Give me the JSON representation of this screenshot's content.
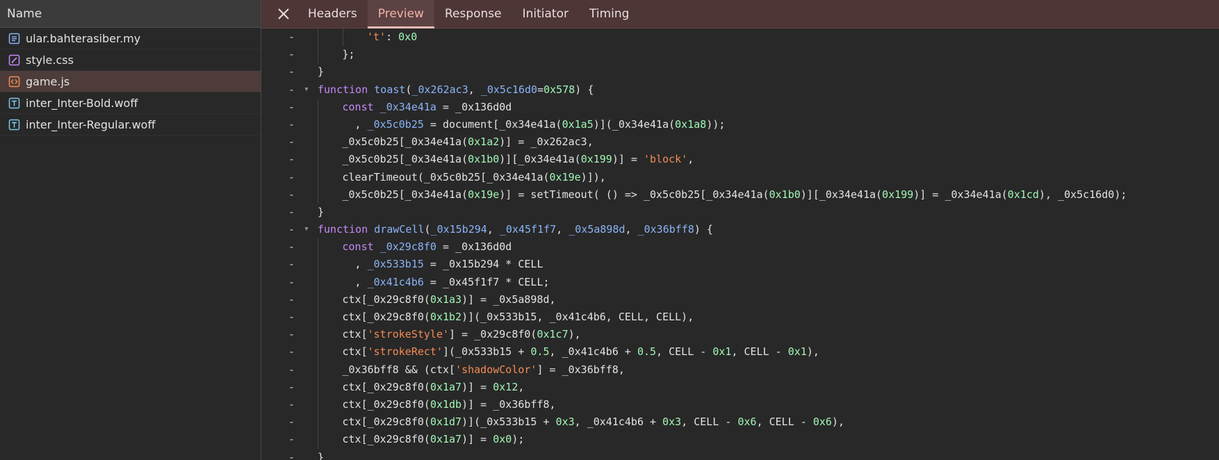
{
  "network": {
    "name_header": "Name",
    "files": [
      {
        "name": "ular.bahterasiber.my",
        "type": "document",
        "icon": "document-icon",
        "color": "#8ab4f8",
        "selected": false
      },
      {
        "name": "style.css",
        "type": "stylesheet",
        "icon": "stylesheet-icon",
        "color": "#c58af9",
        "selected": false
      },
      {
        "name": "game.js",
        "type": "script",
        "icon": "script-icon",
        "color": "#f28b54",
        "selected": true
      },
      {
        "name": "inter_Inter-Bold.woff",
        "type": "font",
        "icon": "font-icon",
        "color": "#7cc6e8",
        "selected": false
      },
      {
        "name": "inter_Inter-Regular.woff",
        "type": "font",
        "icon": "font-icon",
        "color": "#7cc6e8",
        "selected": false
      }
    ]
  },
  "tabs": {
    "close_icon": "close-icon",
    "items": [
      {
        "id": "headers",
        "label": "Headers",
        "active": false
      },
      {
        "id": "preview",
        "label": "Preview",
        "active": true
      },
      {
        "id": "response",
        "label": "Response",
        "active": false
      },
      {
        "id": "initiator",
        "label": "Initiator",
        "active": false
      },
      {
        "id": "timing",
        "label": "Timing",
        "active": false
      }
    ]
  },
  "code": {
    "gutter_mark": "-",
    "fold_icon": "fold-arrow-icon",
    "lines": [
      {
        "indent": 2,
        "fold": false,
        "tokens": [
          [
            "st",
            "'t'"
          ],
          [
            "",
            ": "
          ],
          [
            "nm",
            "0x0"
          ]
        ]
      },
      {
        "indent": 1,
        "fold": false,
        "tokens": [
          [
            "",
            "};"
          ]
        ]
      },
      {
        "indent": 0,
        "fold": false,
        "tokens": [
          [
            "",
            "}"
          ]
        ]
      },
      {
        "indent": 0,
        "fold": true,
        "tokens": [
          [
            "kw",
            "function"
          ],
          [
            "",
            " "
          ],
          [
            "fn",
            "toast"
          ],
          [
            "",
            "("
          ],
          [
            "pm",
            "_0x262ac3"
          ],
          [
            "",
            ", "
          ],
          [
            "pm",
            "_0x5c16d0"
          ],
          [
            "",
            "="
          ],
          [
            "nm",
            "0x578"
          ],
          [
            "",
            ") {"
          ]
        ]
      },
      {
        "indent": 1,
        "fold": false,
        "tokens": [
          [
            "kw",
            "const"
          ],
          [
            "",
            " "
          ],
          [
            "pm",
            "_0x34e41a"
          ],
          [
            "",
            " = _0x136d0d"
          ]
        ]
      },
      {
        "indent": 1,
        "fold": false,
        "tokens": [
          [
            "",
            "  , "
          ],
          [
            "pm",
            "_0x5c0b25"
          ],
          [
            "",
            " = document[_0x34e41a("
          ],
          [
            "nm",
            "0x1a5"
          ],
          [
            "",
            ")](_0x34e41a("
          ],
          [
            "nm",
            "0x1a8"
          ],
          [
            "",
            "));"
          ]
        ]
      },
      {
        "indent": 1,
        "fold": false,
        "tokens": [
          [
            "",
            "_0x5c0b25[_0x34e41a("
          ],
          [
            "nm",
            "0x1a2"
          ],
          [
            "",
            ")] = _0x262ac3,"
          ]
        ]
      },
      {
        "indent": 1,
        "fold": false,
        "tokens": [
          [
            "",
            "_0x5c0b25[_0x34e41a("
          ],
          [
            "nm",
            "0x1b0"
          ],
          [
            "",
            ")][_0x34e41a("
          ],
          [
            "nm",
            "0x199"
          ],
          [
            "",
            ")] = "
          ],
          [
            "st",
            "'block'"
          ],
          [
            "",
            ","
          ]
        ]
      },
      {
        "indent": 1,
        "fold": false,
        "tokens": [
          [
            "",
            "clearTimeout(_0x5c0b25[_0x34e41a("
          ],
          [
            "nm",
            "0x19e"
          ],
          [
            "",
            ")]),"
          ]
        ]
      },
      {
        "indent": 1,
        "fold": false,
        "tokens": [
          [
            "",
            "_0x5c0b25[_0x34e41a("
          ],
          [
            "nm",
            "0x19e"
          ],
          [
            "",
            ")] = setTimeout( () => _0x5c0b25[_0x34e41a("
          ],
          [
            "nm",
            "0x1b0"
          ],
          [
            "",
            ")][_0x34e41a("
          ],
          [
            "nm",
            "0x199"
          ],
          [
            "",
            ")] = _0x34e41a("
          ],
          [
            "nm",
            "0x1cd"
          ],
          [
            "",
            "), _0x5c16d0);"
          ]
        ]
      },
      {
        "indent": 0,
        "fold": false,
        "tokens": [
          [
            "",
            "}"
          ]
        ]
      },
      {
        "indent": 0,
        "fold": true,
        "tokens": [
          [
            "kw",
            "function"
          ],
          [
            "",
            " "
          ],
          [
            "fn",
            "drawCell"
          ],
          [
            "",
            "("
          ],
          [
            "pm",
            "_0x15b294"
          ],
          [
            "",
            ", "
          ],
          [
            "pm",
            "_0x45f1f7"
          ],
          [
            "",
            ", "
          ],
          [
            "pm",
            "_0x5a898d"
          ],
          [
            "",
            ", "
          ],
          [
            "pm",
            "_0x36bff8"
          ],
          [
            "",
            ") {"
          ]
        ]
      },
      {
        "indent": 1,
        "fold": false,
        "tokens": [
          [
            "kw",
            "const"
          ],
          [
            "",
            " "
          ],
          [
            "pm",
            "_0x29c8f0"
          ],
          [
            "",
            " = _0x136d0d"
          ]
        ]
      },
      {
        "indent": 1,
        "fold": false,
        "tokens": [
          [
            "",
            "  , "
          ],
          [
            "pm",
            "_0x533b15"
          ],
          [
            "",
            " = _0x15b294 * CELL"
          ]
        ]
      },
      {
        "indent": 1,
        "fold": false,
        "tokens": [
          [
            "",
            "  , "
          ],
          [
            "pm",
            "_0x41c4b6"
          ],
          [
            "",
            " = _0x45f1f7 * CELL;"
          ]
        ]
      },
      {
        "indent": 1,
        "fold": false,
        "tokens": [
          [
            "",
            "ctx[_0x29c8f0("
          ],
          [
            "nm",
            "0x1a3"
          ],
          [
            "",
            ")] = _0x5a898d,"
          ]
        ]
      },
      {
        "indent": 1,
        "fold": false,
        "tokens": [
          [
            "",
            "ctx[_0x29c8f0("
          ],
          [
            "nm",
            "0x1b2"
          ],
          [
            "",
            ")](_0x533b15, _0x41c4b6, CELL, CELL),"
          ]
        ]
      },
      {
        "indent": 1,
        "fold": false,
        "tokens": [
          [
            "",
            "ctx["
          ],
          [
            "st",
            "'strokeStyle'"
          ],
          [
            "",
            "] = _0x29c8f0("
          ],
          [
            "nm",
            "0x1c7"
          ],
          [
            "",
            "),"
          ]
        ]
      },
      {
        "indent": 1,
        "fold": false,
        "tokens": [
          [
            "",
            "ctx["
          ],
          [
            "st",
            "'strokeRect'"
          ],
          [
            "",
            "](_0x533b15 + "
          ],
          [
            "nm",
            "0.5"
          ],
          [
            "",
            ", _0x41c4b6 + "
          ],
          [
            "nm",
            "0.5"
          ],
          [
            "",
            ", CELL - "
          ],
          [
            "nm",
            "0x1"
          ],
          [
            "",
            ", CELL - "
          ],
          [
            "nm",
            "0x1"
          ],
          [
            "",
            "),"
          ]
        ]
      },
      {
        "indent": 1,
        "fold": false,
        "tokens": [
          [
            "",
            "_0x36bff8 && (ctx["
          ],
          [
            "st",
            "'shadowColor'"
          ],
          [
            "",
            "] = _0x36bff8,"
          ]
        ]
      },
      {
        "indent": 1,
        "fold": false,
        "tokens": [
          [
            "",
            "ctx[_0x29c8f0("
          ],
          [
            "nm",
            "0x1a7"
          ],
          [
            "",
            ")] = "
          ],
          [
            "nm",
            "0x12"
          ],
          [
            "",
            ","
          ]
        ]
      },
      {
        "indent": 1,
        "fold": false,
        "tokens": [
          [
            "",
            "ctx[_0x29c8f0("
          ],
          [
            "nm",
            "0x1db"
          ],
          [
            "",
            ")] = _0x36bff8,"
          ]
        ]
      },
      {
        "indent": 1,
        "fold": false,
        "tokens": [
          [
            "",
            "ctx[_0x29c8f0("
          ],
          [
            "nm",
            "0x1d7"
          ],
          [
            "",
            ")](_0x533b15 + "
          ],
          [
            "nm",
            "0x3"
          ],
          [
            "",
            ", _0x41c4b6 + "
          ],
          [
            "nm",
            "0x3"
          ],
          [
            "",
            ", CELL - "
          ],
          [
            "nm",
            "0x6"
          ],
          [
            "",
            ", CELL - "
          ],
          [
            "nm",
            "0x6"
          ],
          [
            "",
            "),"
          ]
        ]
      },
      {
        "indent": 1,
        "fold": false,
        "tokens": [
          [
            "",
            "ctx[_0x29c8f0("
          ],
          [
            "nm",
            "0x1a7"
          ],
          [
            "",
            ")] = "
          ],
          [
            "nm",
            "0x0"
          ],
          [
            "",
            ");"
          ]
        ]
      },
      {
        "indent": 0,
        "fold": false,
        "tokens": [
          [
            "",
            "}"
          ]
        ]
      }
    ]
  }
}
